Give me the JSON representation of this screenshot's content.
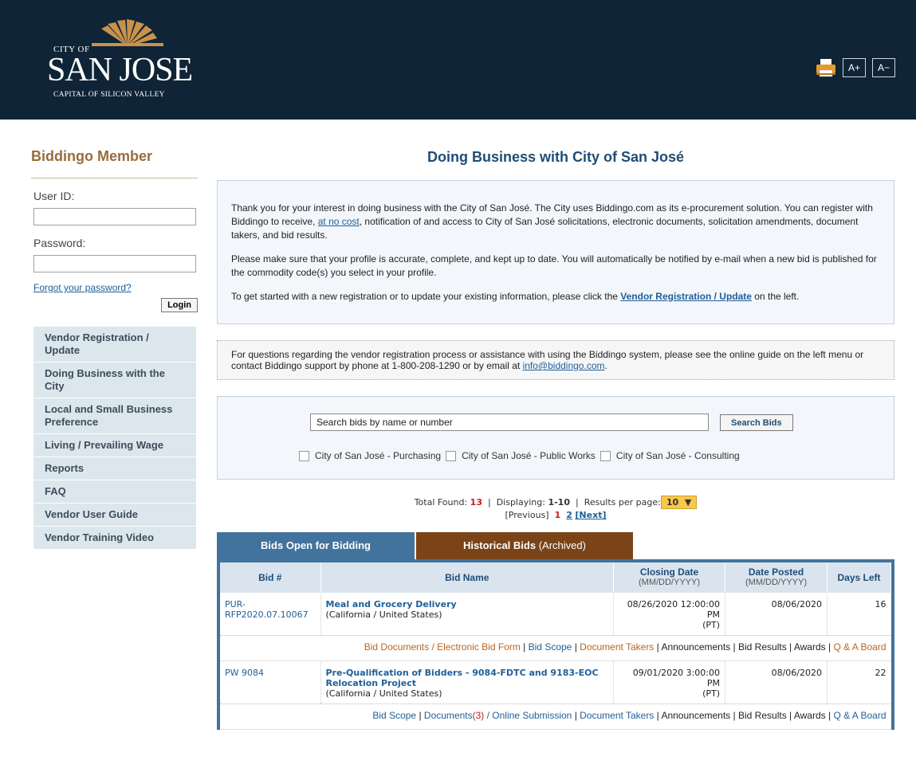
{
  "header": {
    "logo": {
      "city_of": "CITY OF",
      "name": "SAN JOSE",
      "tagline": "CAPITAL OF SILICON VALLEY"
    },
    "font_increase": "A+",
    "font_decrease": "A−"
  },
  "sidebar": {
    "title": "Biddingo Member",
    "user_id_label": "User ID:",
    "password_label": "Password:",
    "forgot_link": "Forgot your password?",
    "login_button": "Login",
    "menu": [
      "Vendor Registration / Update",
      "Doing Business with the City",
      "Local and Small Business Preference",
      "Living / Prevailing Wage",
      "Reports",
      "FAQ",
      "Vendor User Guide",
      "Vendor Training Video"
    ]
  },
  "main": {
    "title": "Doing Business with City of San José",
    "intro": {
      "p1_a": "Thank you for your interest in doing business with the City of San José. The City uses Biddingo.com as its e-procurement solution. You can register with Biddingo to receive, ",
      "p1_link": "at no cost",
      "p1_b": ", notification of and access to City of San José solicitations, electronic documents, solicitation amendments, document takers, and bid results.",
      "p2": "Please make sure that your profile is accurate, complete, and kept up to date. You will automatically be notified by e-mail when a new bid is published for the commodity code(s) you select in your profile.",
      "p3_a": "To get started with a new registration or to update your existing information, please click the ",
      "p3_link": "Vendor Registration / Update",
      "p3_b": " on the left."
    },
    "support": {
      "text": "For questions regarding the vendor registration process or assistance with using the Biddingo system, please see the online guide on the left menu or contact Biddingo support by phone at 1-800-208-1290 or by email at ",
      "email": "info@biddingo.com",
      "end": "."
    },
    "search": {
      "value": "Search bids by name or number",
      "button": "Search Bids",
      "filters": [
        "City of San José - Purchasing",
        "City of San José - Public Works",
        "City of San José - Consulting"
      ]
    },
    "paging": {
      "total_label": "Total Found:",
      "total": "13",
      "displaying_label": "Displaying:",
      "displaying": "1-10",
      "rpp_label": "Results per page:",
      "rpp": "10",
      "rpp_arrow": "▼",
      "prev": "[Previous]",
      "page1": "1",
      "page2": "2",
      "next": "[Next]"
    },
    "tabs": {
      "open": "Bids Open for Bidding",
      "historical": "Historical Bids",
      "historical_suffix": "(Archived)"
    },
    "table": {
      "headers": {
        "bid_no": "Bid #",
        "bid_name": "Bid Name",
        "closing": "Closing Date",
        "closing_sub": "(MM/DD/YYYY)",
        "posted": "Date Posted",
        "posted_sub": "(MM/DD/YYYY)",
        "days": "Days Left"
      },
      "rows": [
        {
          "bid_no": "PUR-RFP2020.07.10067",
          "name": "Meal and Grocery Delivery",
          "location": "(California / United States)",
          "closing": "08/26/2020 12:00:00 PM",
          "tz": "(PT)",
          "posted": "08/06/2020",
          "days": "16"
        },
        {
          "bid_no": "PW 9084",
          "name": "Pre-Qualification of Bidders - 9084-FDTC and 9183-EOC Relocation Project",
          "location": "(California / United States)",
          "closing": "09/01/2020 3:00:00 PM",
          "tz": "(PT)",
          "posted": "08/06/2020",
          "days": "22"
        }
      ],
      "links1": [
        "Bid Documents / Electronic Bid Form",
        "Bid Scope",
        "Document Takers",
        "Announcements",
        "Bid Results",
        "Awards",
        "Q & A Board"
      ],
      "links2": [
        "Bid Scope",
        "Documents",
        "(3)",
        "/ Online Submission",
        "Document Takers",
        "Announcements",
        "Bid Results",
        "Awards",
        "Q & A Board"
      ]
    }
  },
  "colors": {
    "header_bg": "#0f2436",
    "accent_blue": "#42739c",
    "accent_brown": "#7a4418",
    "link": "#1f5f99",
    "sidebar_title": "#9a6b3e"
  },
  "icons": [
    "print-icon"
  ]
}
